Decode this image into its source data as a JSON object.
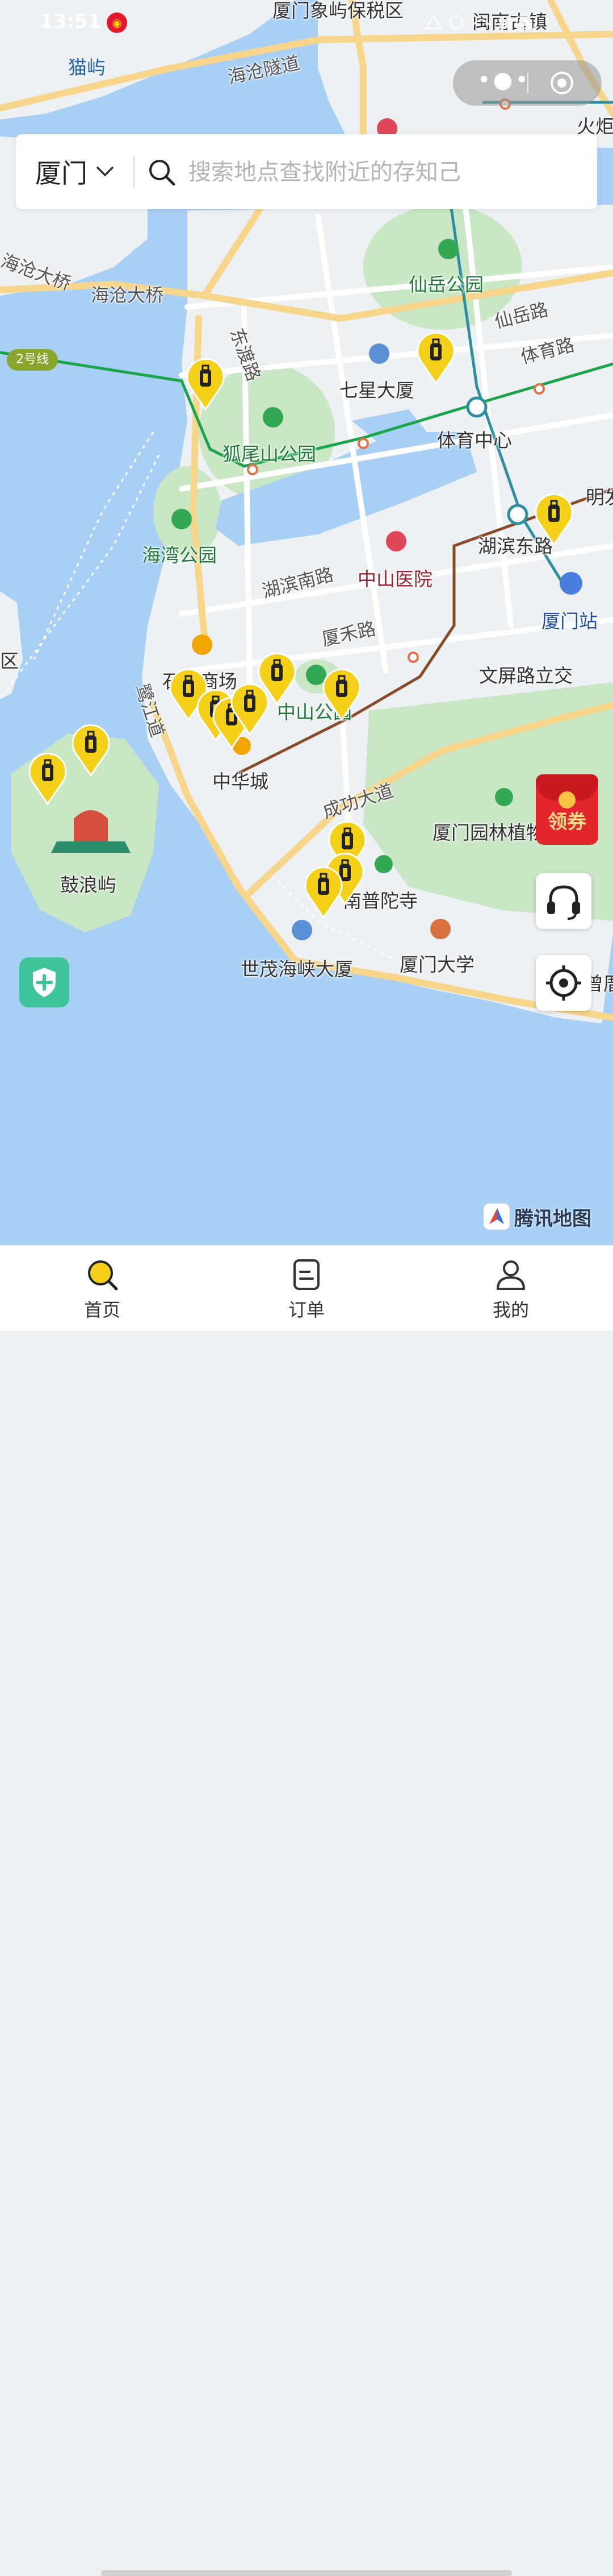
{
  "status_bar": {
    "time": "13:51"
  },
  "search": {
    "city": "厦门",
    "placeholder": "搜索地点查找附近的存知己"
  },
  "map": {
    "labels": {
      "top_area": "厦门象屿保税区",
      "top_town": "闽南古镇",
      "cat_island": "猫屿",
      "haicang_tunnel": "海沧隧道",
      "huoju": "火炬",
      "haicang_bridge_1": "海沧大桥",
      "haicang_bridge_2": "海沧大桥",
      "xianyue_park": "仙岳公园",
      "xianyue_road": "仙岳路",
      "tiyu_road": "体育路",
      "dongdu": "东渡路",
      "qixing": "七星大厦",
      "sports_center": "体育中心",
      "huweishan_park": "狐尾山公园",
      "huwan_park": "海湾公园",
      "hubin_south": "湖滨南路",
      "zhongshan_hospital": "中山医院",
      "hubin_east": "湖滨东路",
      "xiamen_station": "厦门站",
      "xiahe_road": "厦禾路",
      "wenping": "文屏路立交",
      "mall": "石东商场",
      "zhongshan_park": "中山公园",
      "lujiang": "鹭江道",
      "zhonghua": "中华城",
      "chenggong": "成功大道",
      "garden": "厦门园林植物园",
      "gulangyu": "鼓浪屿",
      "nanputuo": "南普陀寺",
      "shimao": "世茂海峡大厦",
      "xmu": "厦门大学",
      "qu": "区",
      "right_edge": "明发",
      "bottom_right": "曾厝垵"
    },
    "metro_line": "2号线"
  },
  "coupon": {
    "label": "领券"
  },
  "attribution": "腾讯地图",
  "tabs": [
    {
      "label": "首页",
      "icon": "search-icon"
    },
    {
      "label": "订单",
      "icon": "order-icon"
    },
    {
      "label": "我的",
      "icon": "profile-icon"
    }
  ],
  "colors": {
    "accent": "#f5d019",
    "sea": "#a8d0f5",
    "land": "#eef1f4",
    "park": "#c9e7c4",
    "pin": "#f5d019",
    "metro_green": "#1aa54a",
    "metro_brown": "#8a4a2a",
    "metro_teal": "#2d8fa0"
  }
}
